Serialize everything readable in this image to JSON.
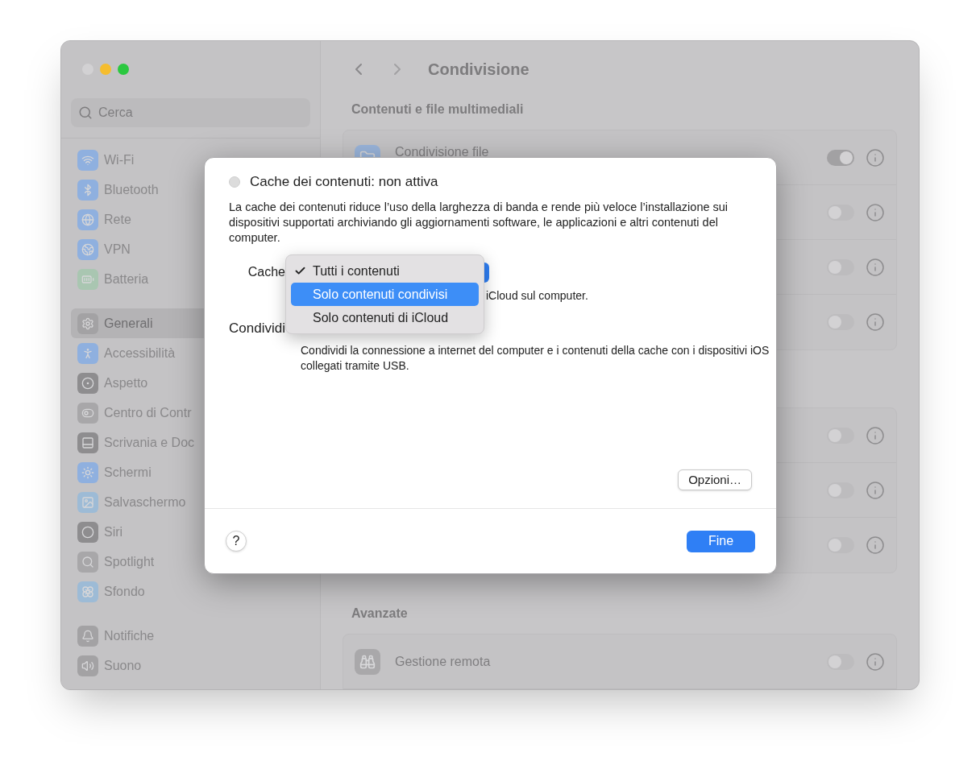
{
  "sidebar": {
    "search": {
      "placeholder": "Cerca"
    },
    "groups": [
      {
        "items": [
          {
            "label": "Wi-Fi",
            "selected": false
          },
          {
            "label": "Bluetooth",
            "selected": false
          },
          {
            "label": "Rete",
            "selected": false
          },
          {
            "label": "VPN",
            "selected": false
          },
          {
            "label": "Batteria",
            "selected": false
          }
        ]
      },
      {
        "items": [
          {
            "label": "Generali",
            "selected": true
          },
          {
            "label": "Accessibilità",
            "selected": false
          },
          {
            "label": "Aspetto",
            "selected": false
          },
          {
            "label": "Centro di Contr",
            "selected": false
          },
          {
            "label": "Scrivania e Doc",
            "selected": false
          },
          {
            "label": "Schermi",
            "selected": false
          },
          {
            "label": "Salvaschermo",
            "selected": false
          },
          {
            "label": "Siri",
            "selected": false
          },
          {
            "label": "Spotlight",
            "selected": false
          },
          {
            "label": "Sfondo",
            "selected": false
          }
        ]
      },
      {
        "items": [
          {
            "label": "Notifiche",
            "selected": false
          },
          {
            "label": "Suono",
            "selected": false
          }
        ]
      }
    ]
  },
  "header": {
    "title": "Condivisione"
  },
  "sections": [
    {
      "title": "Contenuti e file multimediali",
      "rows": [
        {
          "label": "Condivisione file",
          "on": true
        },
        {
          "on": false
        },
        {
          "on": false
        },
        {
          "on": false
        }
      ]
    },
    {
      "rows": [
        {
          "on": false
        },
        {
          "on": false
        },
        {
          "on": false
        }
      ]
    },
    {
      "title": "Avanzate",
      "rows": [
        {
          "label": "Gestione remota",
          "on": false
        }
      ]
    }
  ],
  "dialog": {
    "option": {
      "label": "Cache dei contenuti: non attiva",
      "checked": false
    },
    "description": "La cache dei contenuti riduce l’uso della larghezza di banda e rende più veloce l’installazione sui dispositivi supportati archiviando gli aggiornamenti software, le applicazioni e altri contenuti del computer.",
    "cache_label": "Cache",
    "cache_note": "iCloud sul computer.",
    "share_label": "Condividi",
    "share_note": "Condividi la connessione a internet del computer e i contenuti della cache con i dispositivi iOS collegati tramite USB.",
    "options_button": "Opzioni…",
    "help_button": "?",
    "done_button": "Fine",
    "menu": [
      {
        "label": "Tutti i contenuti",
        "checked": true,
        "highlighted": false
      },
      {
        "label": "Solo contenuti condivisi",
        "checked": false,
        "highlighted": true
      },
      {
        "label": "Solo contenuti di iCloud",
        "checked": false,
        "highlighted": false
      }
    ]
  }
}
